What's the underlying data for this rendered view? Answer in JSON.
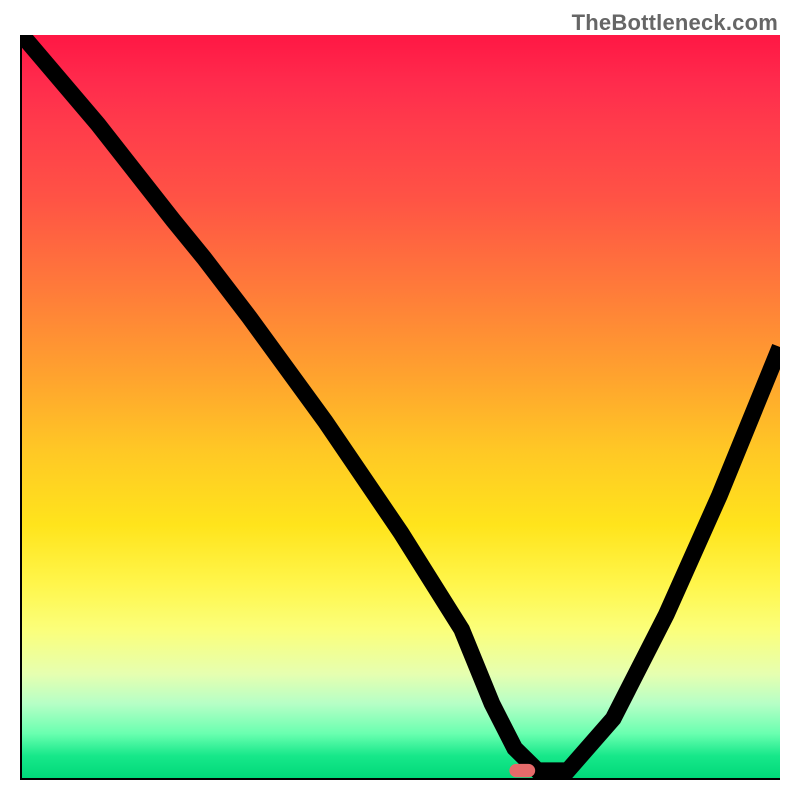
{
  "watermark": "TheBottleneck.com",
  "chart_data": {
    "type": "line",
    "title": "",
    "xlabel": "",
    "ylabel": "",
    "xlim": [
      0,
      100
    ],
    "ylim": [
      0,
      100
    ],
    "grid": false,
    "legend": false,
    "background_gradient": {
      "direction": "top_to_bottom",
      "stops": [
        {
          "pos": 0,
          "color": "#ff1744"
        },
        {
          "pos": 22,
          "color": "#ff5345"
        },
        {
          "pos": 46,
          "color": "#ffa32e"
        },
        {
          "pos": 66,
          "color": "#ffe41c"
        },
        {
          "pos": 86,
          "color": "#e6ffb0"
        },
        {
          "pos": 100,
          "color": "#00d879"
        }
      ]
    },
    "series": [
      {
        "name": "bottleneck-curve",
        "x": [
          0,
          10,
          20,
          24,
          30,
          40,
          50,
          58,
          62,
          65,
          68,
          72,
          78,
          85,
          92,
          100
        ],
        "y": [
          100,
          88,
          75,
          70,
          62,
          48,
          33,
          20,
          10,
          4,
          1,
          1,
          8,
          22,
          38,
          58
        ]
      }
    ],
    "marker": {
      "x": 66,
      "y": 1,
      "color": "#e66a6a",
      "shape": "pill"
    }
  }
}
